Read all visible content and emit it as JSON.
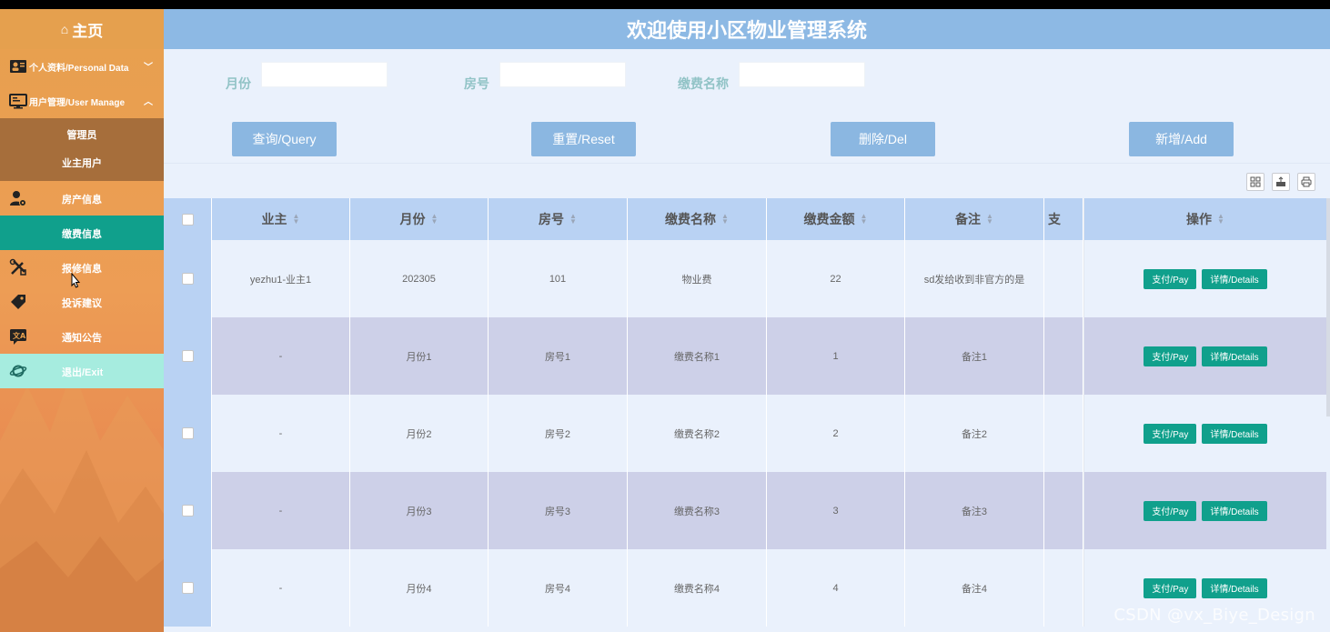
{
  "app": {
    "title": "欢迎使用小区物业管理系统"
  },
  "sidebar": {
    "home_label": "主页",
    "groups": [
      {
        "label": "个人资料/Personal Data",
        "icon": "person-card-icon",
        "expanded": false
      },
      {
        "label": "用户管理/User Manage",
        "icon": "monitor-user-icon",
        "expanded": true,
        "children": [
          "管理员",
          "业主用户"
        ]
      }
    ],
    "items": [
      {
        "label": "房产信息",
        "icon": "user-gear-icon"
      },
      {
        "label": "缴费信息",
        "icon": "none",
        "active": true
      },
      {
        "label": "报修信息",
        "icon": "tools-icon"
      },
      {
        "label": "投诉建议",
        "icon": "tag-icon"
      },
      {
        "label": "通知公告",
        "icon": "translate-icon"
      },
      {
        "label": "退出/Exit",
        "icon": "planet-icon"
      }
    ]
  },
  "filters": {
    "month_label": "月份",
    "month_value": "",
    "room_label": "房号",
    "room_value": "",
    "fee_label": "缴费名称",
    "fee_value": ""
  },
  "actions": {
    "query": "查询/Query",
    "reset": "重置/Reset",
    "delete": "删除/Del",
    "add": "新增/Add"
  },
  "table": {
    "headers": [
      "业主",
      "月份",
      "房号",
      "缴费名称",
      "缴费金额",
      "备注",
      "支",
      "操作"
    ],
    "rows": [
      {
        "owner": "yezhu1-业主1",
        "month": "202305",
        "room": "101",
        "fee_name": "物业费",
        "amount": "22",
        "remark": "sd发给收到非官方的是"
      },
      {
        "owner": "-",
        "month": "月份1",
        "room": "房号1",
        "fee_name": "缴费名称1",
        "amount": "1",
        "remark": "备注1"
      },
      {
        "owner": "-",
        "month": "月份2",
        "room": "房号2",
        "fee_name": "缴费名称2",
        "amount": "2",
        "remark": "备注2"
      },
      {
        "owner": "-",
        "month": "月份3",
        "room": "房号3",
        "fee_name": "缴费名称3",
        "amount": "3",
        "remark": "备注3"
      },
      {
        "owner": "-",
        "month": "月份4",
        "room": "房号4",
        "fee_name": "缴费名称4",
        "amount": "4",
        "remark": "备注4"
      }
    ],
    "pay_label": "支付/Pay",
    "details_label": "详情/Details"
  },
  "watermark": "CSDN @vx_Biye_Design",
  "colors": {
    "header_bg": "#8db9e4",
    "button_bg": "#8bb7e1",
    "accent_teal": "#10a08c",
    "sidebar_orange": "#e7a04e"
  }
}
